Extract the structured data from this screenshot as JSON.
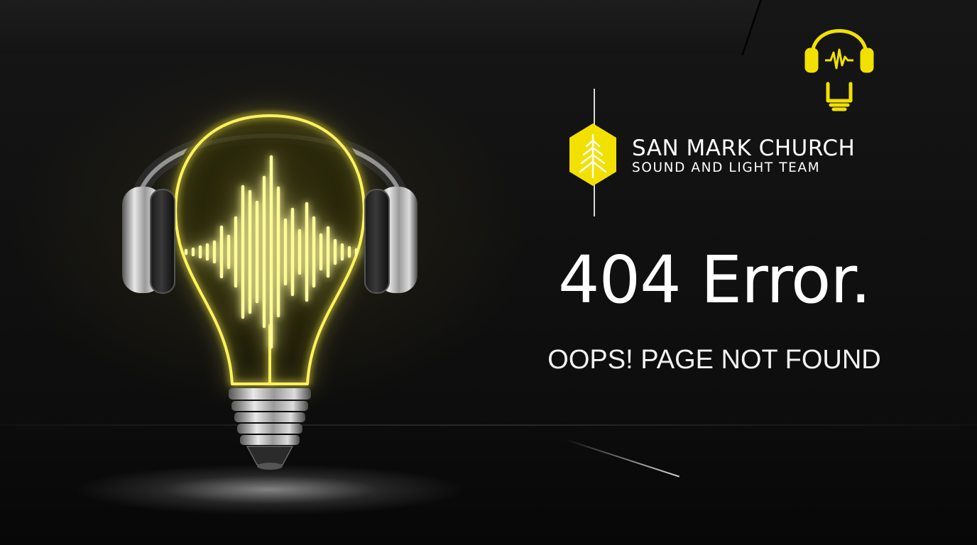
{
  "brand": {
    "name": "SAN MARK CHURCH",
    "subtitle": "SOUND AND LIGHT TEAM",
    "accent_color": "#f2e100"
  },
  "error": {
    "title": "404 Error.",
    "message": "OOPS! PAGE NOT FOUND"
  },
  "icons": {
    "hero": "lightbulb-headphones-soundwave-icon",
    "corner": "headphones-bulb-icon",
    "brand_mark": "hexagon-tree-icon"
  }
}
